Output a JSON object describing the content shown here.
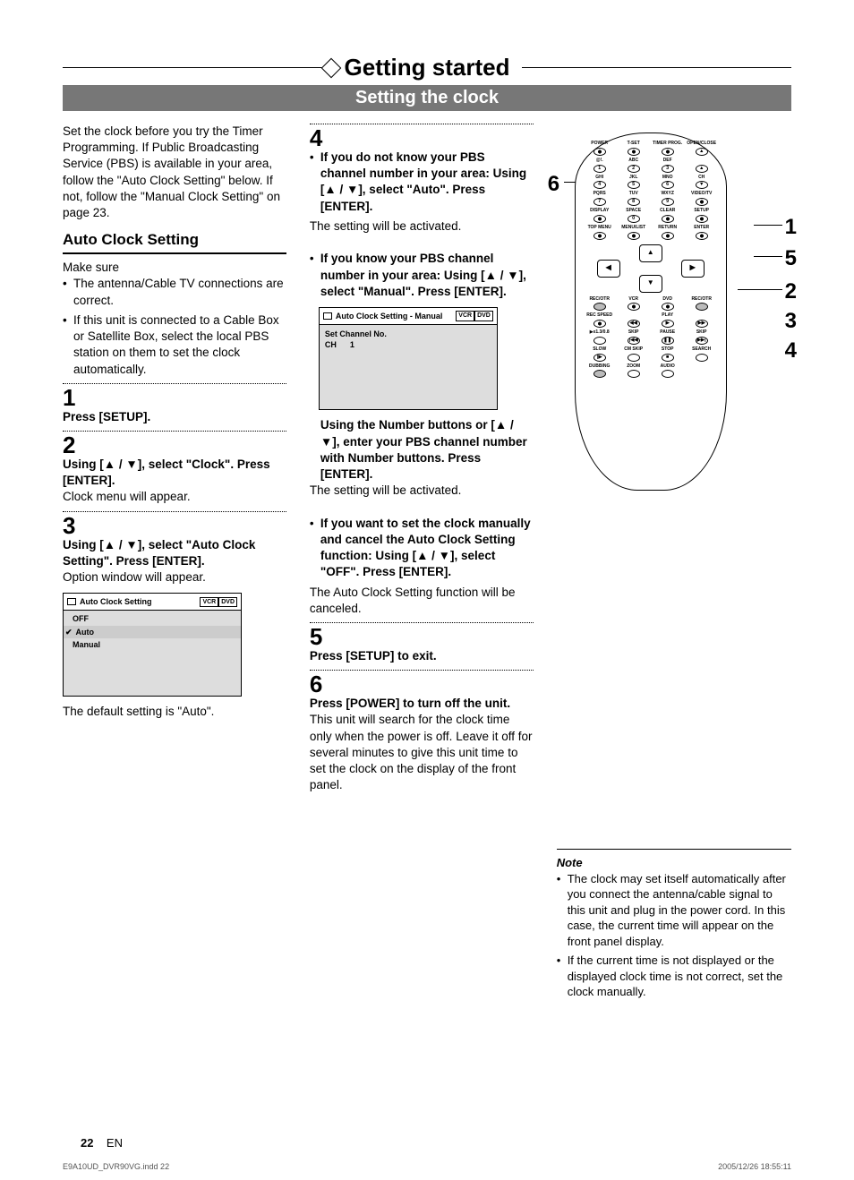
{
  "header": {
    "title": "Getting started",
    "subtitle": "Setting the clock"
  },
  "intro": "Set the clock before you try the Timer Programming. If Public Broadcasting Service (PBS) is available in your area, follow the \"Auto Clock Setting\" below. If not, follow the \"Manual Clock Setting\" on page 23.",
  "section_auto": {
    "heading": "Auto Clock Setting",
    "makesure_label": "Make sure",
    "makesure": [
      "The antenna/Cable TV connections are correct.",
      "If this unit is connected to a Cable Box or Satellite Box, select the local PBS station on them to set the clock automatically."
    ],
    "step1": {
      "num": "1",
      "bold": "Press [SETUP]."
    },
    "step2": {
      "num": "2",
      "bold": "Using [▲ / ▼], select \"Clock\". Press [ENTER].",
      "text": "Clock menu will appear."
    },
    "step3": {
      "num": "3",
      "bold": "Using [▲ / ▼], select \"Auto Clock Setting\". Press [ENTER].",
      "text": "Option window will appear.",
      "after": "The default setting is \"Auto\"."
    }
  },
  "osd1": {
    "title": "Auto Clock Setting",
    "tag1": "VCR",
    "tag2": "DVD",
    "rows": [
      "OFF",
      "Auto",
      "Manual"
    ]
  },
  "col2": {
    "step4": {
      "num": "4",
      "b1_bold": "If you do not know your PBS channel number in your area: Using [▲ / ▼], select \"Auto\". Press [ENTER].",
      "b1_text": "The setting will be activated.",
      "b2_bold": "If you know your PBS channel number in your area: Using [▲ / ▼], select \"Manual\". Press [ENTER].",
      "mid_bold": "Using the Number buttons or [▲ / ▼], enter your PBS channel number with Number buttons. Press [ENTER].",
      "mid_text": "The setting will be activated.",
      "b3_bold": "If you want to set the clock manually and cancel the Auto Clock Setting function: Using [▲ / ▼], select \"OFF\". Press [ENTER].",
      "b3_text": "The Auto Clock Setting function will be canceled."
    },
    "step5": {
      "num": "5",
      "bold": "Press [SETUP] to exit."
    },
    "step6": {
      "num": "6",
      "bold": "Press [POWER] to turn off the unit.",
      "text": "This unit will search for the clock time only when the power is off. Leave it off for several minutes to give this unit time to set the clock on the display of the front panel."
    }
  },
  "osd2": {
    "title": "Auto Clock Setting - Manual",
    "tag1": "VCR",
    "tag2": "DVD",
    "line1": "Set Channel No.",
    "line2a": "CH",
    "line2b": "1"
  },
  "remote": {
    "row1": [
      "POWER",
      "T-SET",
      "TIMER PROG.",
      "OPEN/CLOSE"
    ],
    "row2": [
      "@!.",
      "ABC",
      "DEF",
      ""
    ],
    "row2b": [
      "1",
      "2",
      "3",
      "▲"
    ],
    "row3": [
      "GHI",
      "JKL",
      "MNO",
      "CH"
    ],
    "row3b": [
      "4",
      "5",
      "6",
      "▼"
    ],
    "row4": [
      "PQRS",
      "TUV",
      "WXYZ",
      "VIDEO/TV"
    ],
    "row4b": [
      "7",
      "8",
      "9",
      ""
    ],
    "row5": [
      "DISPLAY",
      "SPACE",
      "CLEAR",
      "SETUP"
    ],
    "row5b": [
      "",
      "0",
      "",
      ""
    ],
    "row6": [
      "TOP MENU",
      "MENU/LIST",
      "RETURN",
      "ENTER"
    ],
    "row7": [
      "REC/OTR",
      "VCR",
      "DVD",
      "REC/OTR"
    ],
    "row8": [
      "REC SPEED",
      "",
      "PLAY",
      ""
    ],
    "row9": [
      "▶x1.3/0.8",
      "SKIP",
      "PAUSE",
      "SKIP"
    ],
    "row10": [
      "SLOW",
      "CM SKIP",
      "STOP",
      "SEARCH"
    ],
    "row11": [
      "DUBBING",
      "ZOOM",
      "AUDIO",
      ""
    ]
  },
  "callouts": {
    "c6": "6",
    "c1": "1",
    "c5": "5",
    "c2": "2",
    "c3": "3",
    "c4": "4"
  },
  "note": {
    "title": "Note",
    "items": [
      "The clock may set itself automatically after you connect the antenna/cable signal to this unit and plug in the power cord. In this case, the current time will appear on the front panel display.",
      "If the current time is not displayed or the displayed clock time is not correct, set the clock manually."
    ]
  },
  "footer": {
    "page": "22",
    "lang": "EN"
  },
  "printfooter": {
    "left": "E9A10UD_DVR90VG.indd   22",
    "right": "2005/12/26   18:55:11"
  }
}
